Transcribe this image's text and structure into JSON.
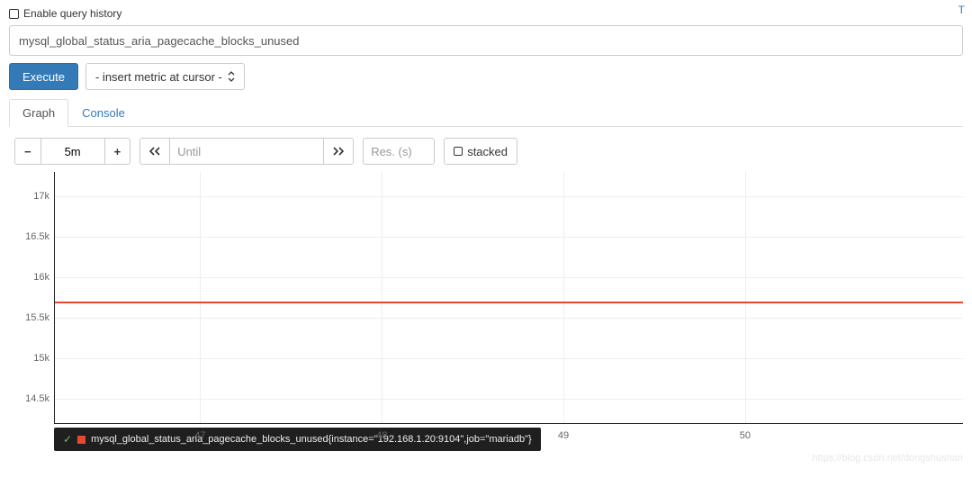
{
  "header": {
    "enable_history_label": "Enable query history",
    "top_right_letter": "T"
  },
  "query": {
    "value": "mysql_global_status_aria_pagecache_blocks_unused"
  },
  "actions": {
    "execute_label": "Execute",
    "metric_dropdown_label": "- insert metric at cursor -"
  },
  "tabs": {
    "graph": "Graph",
    "console": "Console",
    "active": "graph"
  },
  "controls": {
    "minus": "−",
    "plus": "+",
    "range_value": "5m",
    "until_placeholder": "Until",
    "until_value": "",
    "res_placeholder": "Res. (s)",
    "stacked_label": "stacked"
  },
  "chart_data": {
    "type": "line",
    "y_ticks": [
      14.5,
      15,
      15.5,
      16,
      16.5,
      17
    ],
    "y_tick_labels": [
      "14.5k",
      "15k",
      "15.5k",
      "16k",
      "16.5k",
      "17k"
    ],
    "ylim": [
      14.2,
      17.3
    ],
    "x_ticks": [
      47,
      48,
      49,
      50
    ],
    "xlim": [
      46.2,
      51.2
    ],
    "series": [
      {
        "name": "mysql_global_status_aria_pagecache_blocks_unused{instance=\"192.168.1.20:9104\",job=\"mariadb\"}",
        "color": "#e2492f",
        "constant_value": 15.7
      }
    ]
  },
  "watermark": "https://blog.csdn.net/dongshushan"
}
